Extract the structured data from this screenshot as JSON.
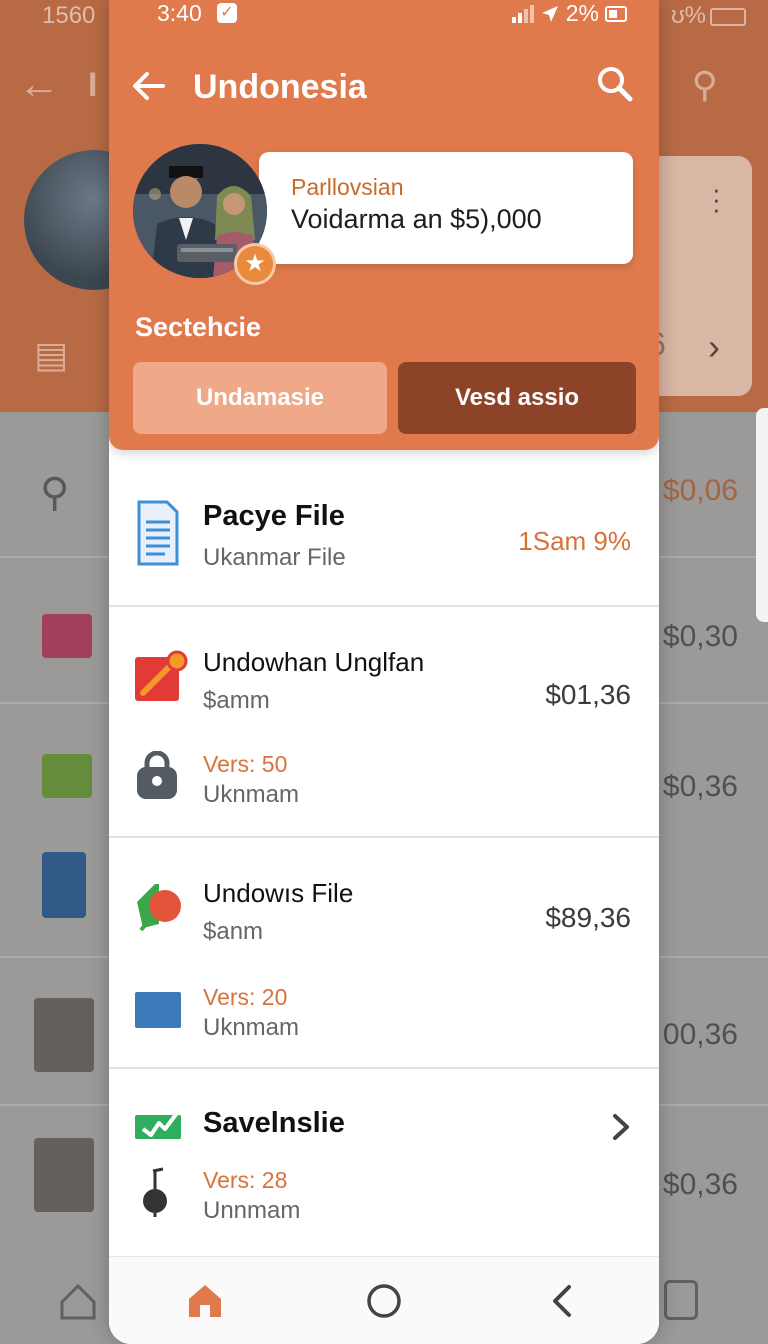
{
  "background": {
    "status_left": "1560",
    "status_right": "ʊ%",
    "header_text_partial": "I",
    "price_top": "$0,06",
    "prices": [
      "$0,30",
      "$0,36",
      "00,36",
      "$0,36"
    ]
  },
  "status_bar": {
    "time": "3:40",
    "battery": "2%"
  },
  "header": {
    "title": "Undonesia"
  },
  "profile_card": {
    "subtitle": "Parllovsian",
    "text": "Voidarma an $5),000"
  },
  "section": {
    "label": "Sectehcie"
  },
  "buttons": {
    "light": "Undamasie",
    "dark": "Vesd assio"
  },
  "list": [
    {
      "title": "Pacye File",
      "subtitle": "Ukanmar File",
      "badge": "1Sam 9%",
      "icon": "document-icon"
    },
    {
      "title": "Undowhan Unglfan",
      "subtitle": "$amm",
      "price": "$01,36",
      "version": "Vers: 50",
      "version_sub": "Uknmam",
      "icon": "edit-icon",
      "version_icon": "lock-icon"
    },
    {
      "title": "Undowıs File",
      "subtitle": "$anm",
      "price": "$89,36",
      "version": "Vers: 20",
      "version_sub": "Uknmam",
      "icon": "tag-icon",
      "version_icon": "folder-icon"
    },
    {
      "title": "Savelnslie",
      "version": "Vers: 28",
      "version_sub": "Unnmam",
      "icon": "check-icon",
      "version_icon": "music-icon"
    }
  ],
  "colors": {
    "accent": "#e07a4c",
    "accent_dark": "#8c4327",
    "accent_light": "#f0a988",
    "orange_text": "#d7733a"
  }
}
